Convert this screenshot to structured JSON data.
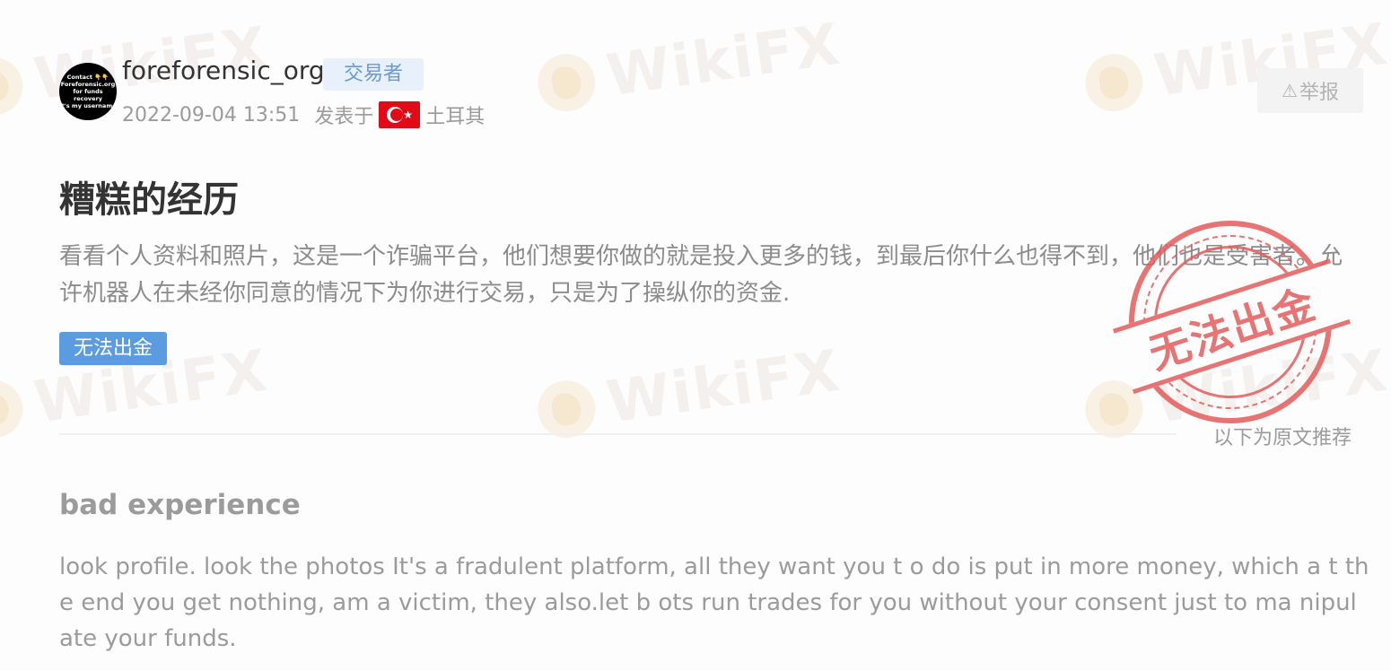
{
  "watermark": {
    "text": "WikiFX"
  },
  "author": {
    "username": "foreforensic_org",
    "role": "交易者",
    "avatar_lines": [
      "Contact 👇👇",
      "Foreforensic.org",
      "for funds recovery",
      "it's my username"
    ]
  },
  "post_meta": {
    "time": "2022-09-04 13:51",
    "posted_in": "发表于",
    "country": "土耳其",
    "country_flag_icon": "turkey-flag"
  },
  "report_button": {
    "icon": "warning-icon",
    "label": "举报"
  },
  "review_zh": {
    "title": "糟糕的经历",
    "body": "看看个人资料和照片，这是一个诈骗平台，他们想要你做的就是投入更多的钱，到最后你什么也得不到，他们也是受害者。允许机器人在未经你同意的情况下为你进行交易，只是为了操纵你的资金.",
    "issue_tag": "无法出金"
  },
  "stamp": {
    "text": "无法出金",
    "color": "#e45b5b"
  },
  "original_note": "以下为原文推荐",
  "review_en": {
    "title": "bad experience",
    "body": "look profile. look the photos It's a fradulent platform, all they want you t o do is put in more money, which a t the end you get nothing, am a victim, they also.let b ots run trades for you without your consent just to ma nipulate your funds."
  },
  "colors": {
    "tag_blue": "#5b9be0",
    "role_tag_bg": "#e7f0fb",
    "role_tag_text": "#6a9bd6",
    "muted_text": "#9b9b9b"
  }
}
